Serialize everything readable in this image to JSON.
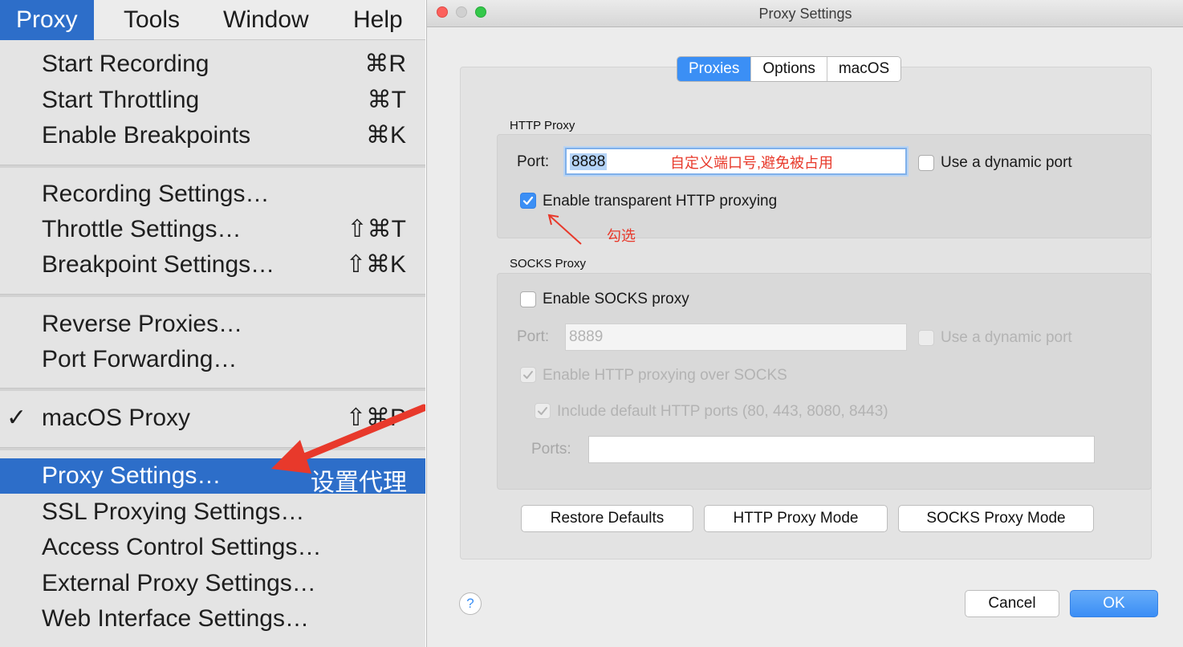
{
  "menubar": {
    "items": [
      {
        "label": "Proxy",
        "active": true
      },
      {
        "label": "Tools",
        "active": false
      },
      {
        "label": "Window",
        "active": false
      },
      {
        "label": "Help",
        "active": false
      }
    ]
  },
  "menu": {
    "items": [
      {
        "label": "Start Recording",
        "shortcut": "⌘R"
      },
      {
        "label": "Start Throttling",
        "shortcut": "⌘T"
      },
      {
        "label": "Enable Breakpoints",
        "shortcut": "⌘K"
      },
      {
        "label": "Recording Settings…",
        "shortcut": ""
      },
      {
        "label": "Throttle Settings…",
        "shortcut": "⇧⌘T"
      },
      {
        "label": "Breakpoint Settings…",
        "shortcut": "⇧⌘K"
      },
      {
        "label": "Reverse Proxies…",
        "shortcut": ""
      },
      {
        "label": "Port Forwarding…",
        "shortcut": ""
      },
      {
        "label": "macOS Proxy",
        "shortcut": "⇧⌘P",
        "checked": true,
        "check_mark": "✓"
      },
      {
        "label": "Proxy Settings…",
        "shortcut": "",
        "highlighted": true
      },
      {
        "label": "SSL Proxying Settings…",
        "shortcut": ""
      },
      {
        "label": "Access Control Settings…",
        "shortcut": ""
      },
      {
        "label": "External Proxy Settings…",
        "shortcut": ""
      },
      {
        "label": "Web Interface Settings…",
        "shortcut": ""
      }
    ],
    "annotation": "设置代理"
  },
  "dialog": {
    "title": "Proxy Settings",
    "tabs": [
      {
        "label": "Proxies",
        "selected": true
      },
      {
        "label": "Options",
        "selected": false
      },
      {
        "label": "macOS",
        "selected": false
      }
    ],
    "http_proxy": {
      "title": "HTTP Proxy",
      "port_label": "Port:",
      "port_value": "8888",
      "port_annotation": "自定义端口号,避免被占用",
      "dynamic_port_label": "Use a dynamic port",
      "dynamic_port_checked": false,
      "transparent_label": "Enable transparent HTTP proxying",
      "transparent_checked": true,
      "transparent_annotation": "勾选"
    },
    "socks_proxy": {
      "title": "SOCKS Proxy",
      "enable_label": "Enable SOCKS proxy",
      "enable_checked": false,
      "port_label": "Port:",
      "port_placeholder": "8889",
      "dynamic_port_label": "Use a dynamic port",
      "http_over_socks_label": "Enable HTTP proxying over SOCKS",
      "include_ports_label": "Include default HTTP ports (80, 443, 8080, 8443)",
      "ports_label": "Ports:",
      "ports_value": ""
    },
    "buttons": {
      "restore": "Restore Defaults",
      "http_mode": "HTTP Proxy Mode",
      "socks_mode": "SOCKS Proxy Mode",
      "cancel": "Cancel",
      "ok": "OK",
      "help": "?"
    }
  },
  "colors": {
    "menu_highlight": "#2d6ec9",
    "accent": "#3b8ff5",
    "annotation_red": "#e8392b"
  }
}
